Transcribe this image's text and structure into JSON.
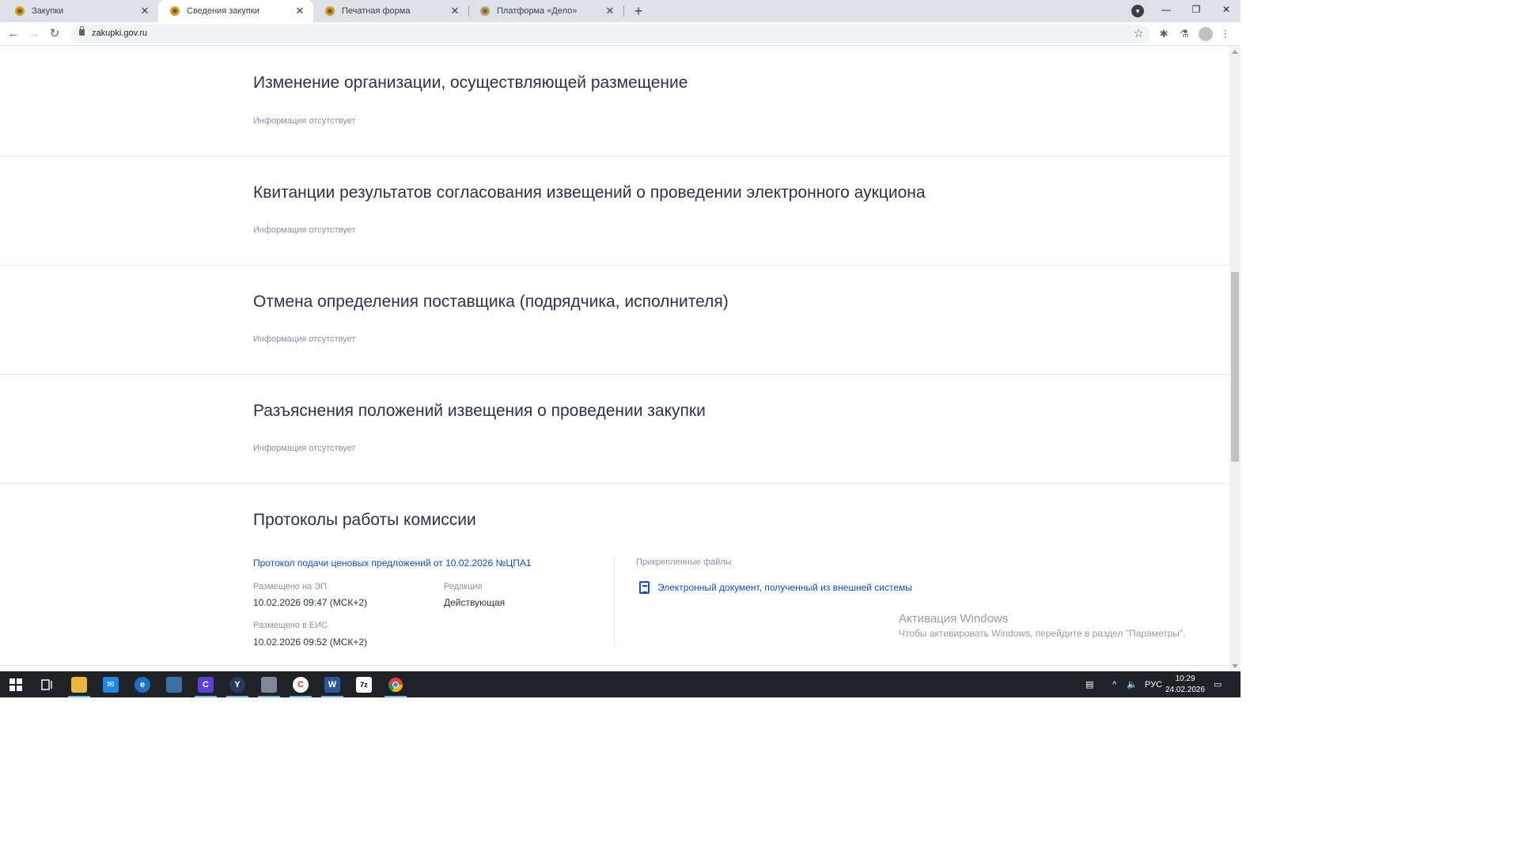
{
  "browser": {
    "tabs": [
      {
        "title": "Закупки",
        "active": false
      },
      {
        "title": "Сведения закупки",
        "active": true
      },
      {
        "title": "Печатная форма",
        "active": false
      },
      {
        "title": "Платформа «Дело»",
        "active": false
      }
    ],
    "url": "zakupki.gov.ru"
  },
  "sections": [
    {
      "title": "Изменение организации, осуществляющей размещение",
      "empty_text": "Информация отсутствует"
    },
    {
      "title": "Квитанции результатов согласования извещений о проведении электронного аукциона",
      "empty_text": "Информация отсутствует"
    },
    {
      "title": "Отмена определения поставщика (подрядчика, исполнителя)",
      "empty_text": "Информация отсутствует"
    },
    {
      "title": "Разъяснения положений извещения о проведении закупки",
      "empty_text": "Информация отсутствует"
    }
  ],
  "protocols": {
    "title": "Протоколы работы комиссии",
    "protocol_link": "Протокол подачи ценовых предложений от 10.02.2026 №ЦПА1",
    "placed_ep_label": "Размещено на ЭП",
    "placed_ep_value": "10.02.2026 09:47 (МСК+2)",
    "edition_label": "Редакция",
    "edition_value": "Действующая",
    "placed_eis_label": "Размещено в ЕИС",
    "placed_eis_value": "10.02.2026 09:52 (МСК+2)",
    "attached_files_label": "Прикрепленные файлы",
    "file_link": "Электронный документ, полученный из внешней системы"
  },
  "watermark": {
    "title": "Активация Windows",
    "text": "Чтобы активировать Windows, перейдите в раздел \"Параметры\"."
  },
  "taskbar": {
    "language": "РУС",
    "time": "10:29",
    "date": "24.02.2026"
  },
  "colors": {
    "link": "#0d4cd3",
    "heading": "#2b3348",
    "muted": "#8a91a8",
    "divider": "#e4e7f2"
  }
}
